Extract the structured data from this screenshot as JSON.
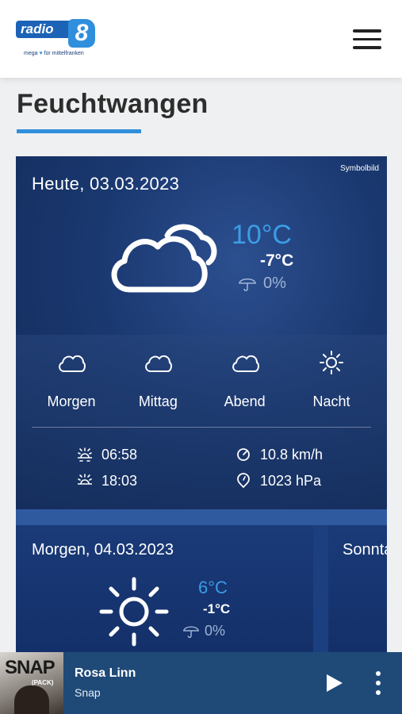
{
  "header": {
    "logo_text": "radio",
    "logo_number": "8",
    "logo_tagline_a": "mega",
    "logo_tagline_b": "für mittelfranken",
    "menu_icon": "hamburger-menu-icon"
  },
  "page": {
    "city": "Feuchtwangen",
    "accent_color": "#2f8fdc"
  },
  "today": {
    "image_label": "Symbolbild",
    "date": "Heute, 03.03.2023",
    "icon": "cloudy-icon",
    "temp_high": "10°C",
    "temp_low": "-7°C",
    "precipitation": "0%",
    "periods": [
      {
        "label": "Morgen",
        "icon": "cloud-icon"
      },
      {
        "label": "Mittag",
        "icon": "cloud-icon"
      },
      {
        "label": "Abend",
        "icon": "cloud-icon"
      },
      {
        "label": "Nacht",
        "icon": "sun-icon"
      }
    ],
    "sunrise": "06:58",
    "sunset": "18:03",
    "wind": "10.8 km/h",
    "pressure": "1023 hPa"
  },
  "tomorrow": {
    "date": "Morgen, 04.03.2023",
    "icon": "sun-icon",
    "temp_high": "6°C",
    "temp_low": "-1°C",
    "precipitation": "0%"
  },
  "next_day": {
    "date": "Sonnta"
  },
  "player": {
    "cover_title": "SNAP",
    "cover_subtitle": "(PACK)",
    "artist": "Rosa Linn",
    "song": "Snap"
  }
}
